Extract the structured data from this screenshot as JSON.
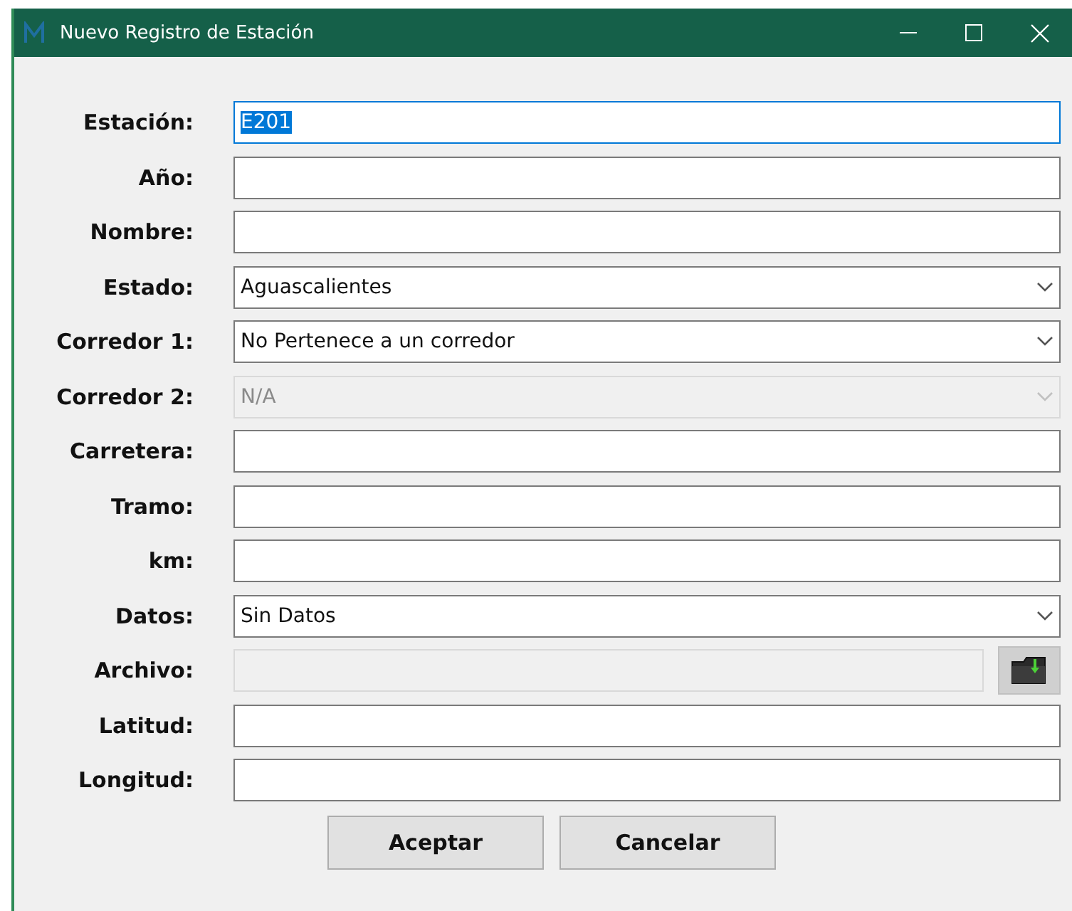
{
  "window": {
    "title": "Nuevo Registro de Estación"
  },
  "fields": [
    {
      "label": "Estación:",
      "kind": "text",
      "value": "E201",
      "disabled": false,
      "focused": true
    },
    {
      "label": "Año:",
      "kind": "text",
      "disabled": false,
      "focused": false
    },
    {
      "label": "Nombre:",
      "kind": "text",
      "disabled": false,
      "focused": false
    },
    {
      "label": "Estado:",
      "kind": "select",
      "value": "Aguascalientes",
      "disabled": false,
      "focused": false
    },
    {
      "label": "Corredor 1:",
      "kind": "select",
      "value": "No Pertenece a un corredor",
      "disabled": false,
      "focused": false
    },
    {
      "label": "Corredor 2:",
      "kind": "select",
      "value": "N/A",
      "disabled": true,
      "focused": false
    },
    {
      "label": "Carretera:",
      "kind": "text",
      "disabled": false,
      "focused": false
    },
    {
      "label": "Tramo:",
      "kind": "text",
      "disabled": false,
      "focused": false
    },
    {
      "label": "km:",
      "kind": "text",
      "disabled": false,
      "focused": false
    },
    {
      "label": "Datos:",
      "kind": "select",
      "value": "Sin Datos",
      "disabled": false,
      "focused": false
    },
    {
      "label": "Archivo:",
      "kind": "file",
      "disabled": true,
      "focused": false
    },
    {
      "label": "Latitud:",
      "kind": "text",
      "disabled": false,
      "focused": false
    },
    {
      "label": "Longitud:",
      "kind": "text",
      "disabled": false,
      "focused": false
    }
  ],
  "buttons": [
    "Aceptar",
    "Cancelar"
  ]
}
